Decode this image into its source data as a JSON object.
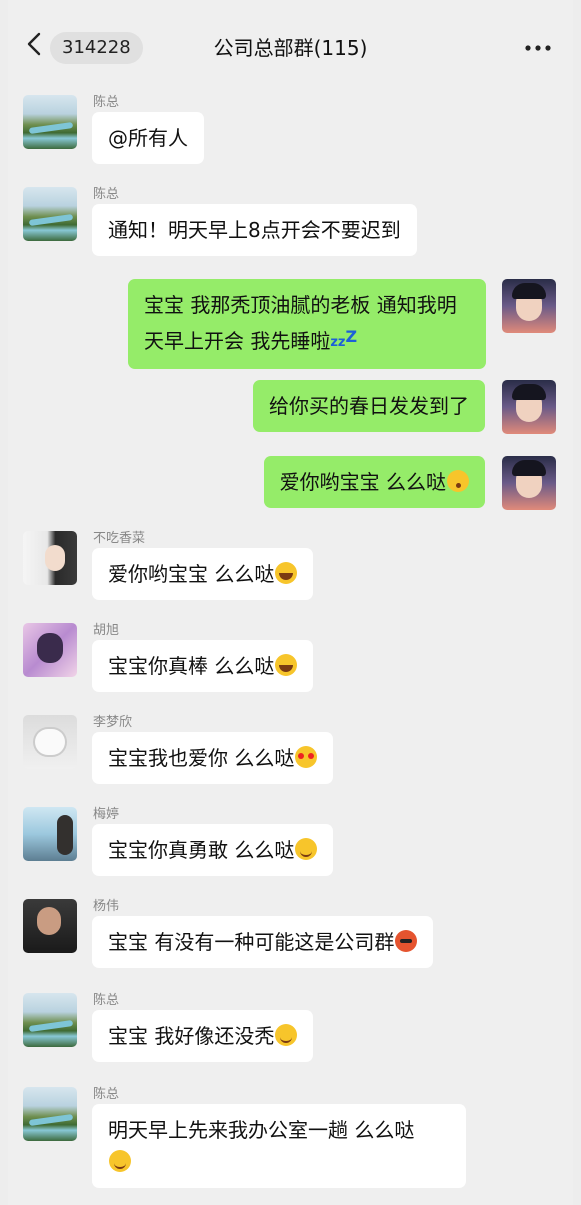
{
  "header": {
    "back_icon": "chevron-left-icon",
    "unread_count": "314228",
    "title": "公司总部群(115)",
    "more_icon": "ellipsis-icon"
  },
  "messages": [
    {
      "sender": "陈总",
      "text": "@所有人",
      "side": "left"
    },
    {
      "sender": "陈总",
      "text": "通知！明天早上8点开会不要迟到",
      "side": "left"
    },
    {
      "sender": "",
      "text": "宝宝 我那秃顶油腻的老板 通知我明天早上开会 我先睡啦",
      "trailing": "zzz",
      "side": "right"
    },
    {
      "sender": "",
      "text": "给你买的春日发发到了",
      "side": "right"
    },
    {
      "sender": "",
      "text": "爱你哟宝宝 么么哒",
      "emoji": "kissing-face",
      "side": "right"
    },
    {
      "sender": "不吃香菜",
      "text": "爱你哟宝宝 么么哒",
      "emoji": "laughing-face",
      "side": "left"
    },
    {
      "sender": "胡旭",
      "text": "宝宝你真棒 么么哒",
      "emoji": "laughing-face",
      "side": "left"
    },
    {
      "sender": "李梦欣",
      "text": "宝宝我也爱你 么么哒",
      "emoji": "heart-eyes-face",
      "side": "left"
    },
    {
      "sender": "梅婷",
      "text": "宝宝你真勇敢 么么哒",
      "emoji": "smiling-face",
      "side": "left"
    },
    {
      "sender": "杨伟",
      "text": "宝宝 有没有一种可能这是公司群",
      "emoji": "angry-face",
      "side": "left"
    },
    {
      "sender": "陈总",
      "text": "宝宝 我好像还没秃",
      "emoji": "smiling-face",
      "side": "left"
    },
    {
      "sender": "陈总",
      "text": "明天早上先来我办公室一趟 么么哒",
      "emoji": "smiling-face",
      "side": "left"
    }
  ]
}
